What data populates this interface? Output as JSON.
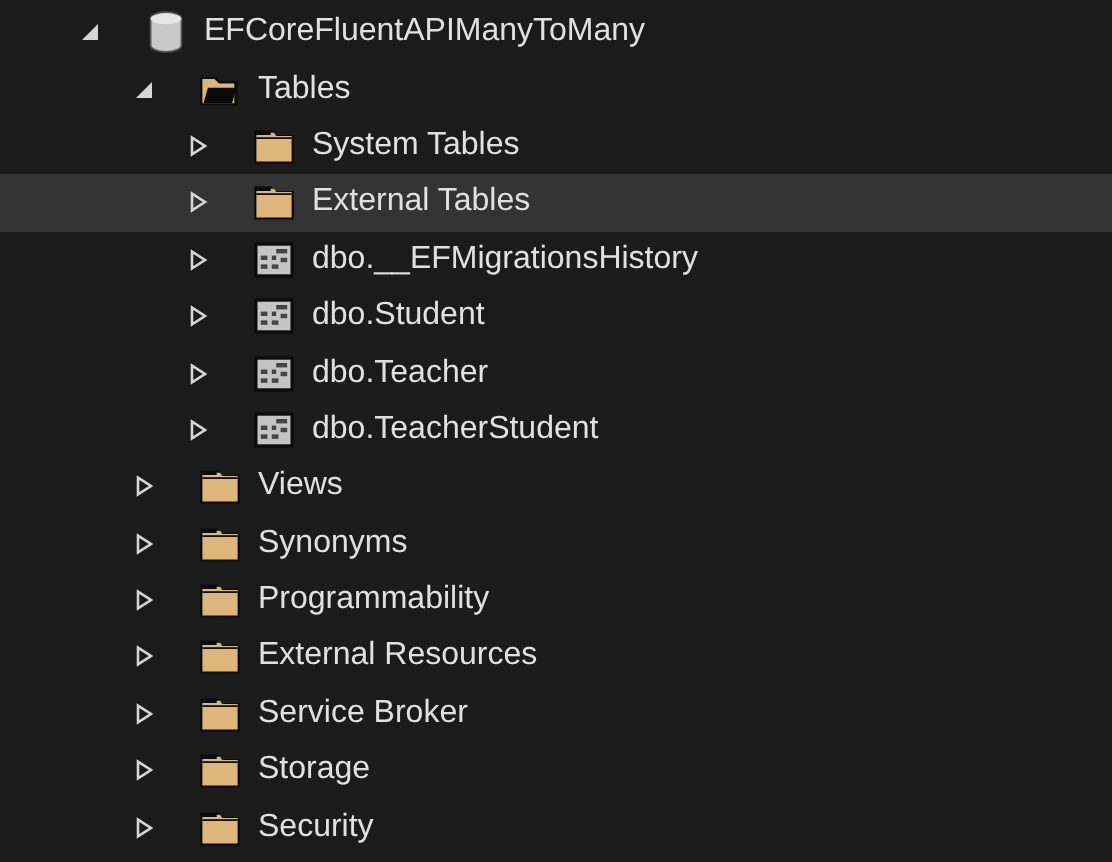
{
  "tree": [
    {
      "label": "EFCoreFluentAPIManyToMany",
      "kind": "database",
      "expanded": true,
      "selected": false,
      "children": [
        {
          "label": "Tables",
          "kind": "folder",
          "expanded": true,
          "selected": false,
          "children": [
            {
              "label": "System Tables",
              "kind": "folder",
              "expanded": false,
              "selected": false
            },
            {
              "label": "External Tables",
              "kind": "folder",
              "expanded": false,
              "selected": true
            },
            {
              "label": "dbo.__EFMigrationsHistory",
              "kind": "table",
              "expanded": false,
              "selected": false
            },
            {
              "label": "dbo.Student",
              "kind": "table",
              "expanded": false,
              "selected": false
            },
            {
              "label": "dbo.Teacher",
              "kind": "table",
              "expanded": false,
              "selected": false
            },
            {
              "label": "dbo.TeacherStudent",
              "kind": "table",
              "expanded": false,
              "selected": false
            }
          ]
        },
        {
          "label": "Views",
          "kind": "folder",
          "expanded": false,
          "selected": false
        },
        {
          "label": "Synonyms",
          "kind": "folder",
          "expanded": false,
          "selected": false
        },
        {
          "label": "Programmability",
          "kind": "folder",
          "expanded": false,
          "selected": false
        },
        {
          "label": "External Resources",
          "kind": "folder",
          "expanded": false,
          "selected": false
        },
        {
          "label": "Service Broker",
          "kind": "folder",
          "expanded": false,
          "selected": false
        },
        {
          "label": "Storage",
          "kind": "folder",
          "expanded": false,
          "selected": false
        },
        {
          "label": "Security",
          "kind": "folder",
          "expanded": false,
          "selected": false
        }
      ]
    }
  ]
}
